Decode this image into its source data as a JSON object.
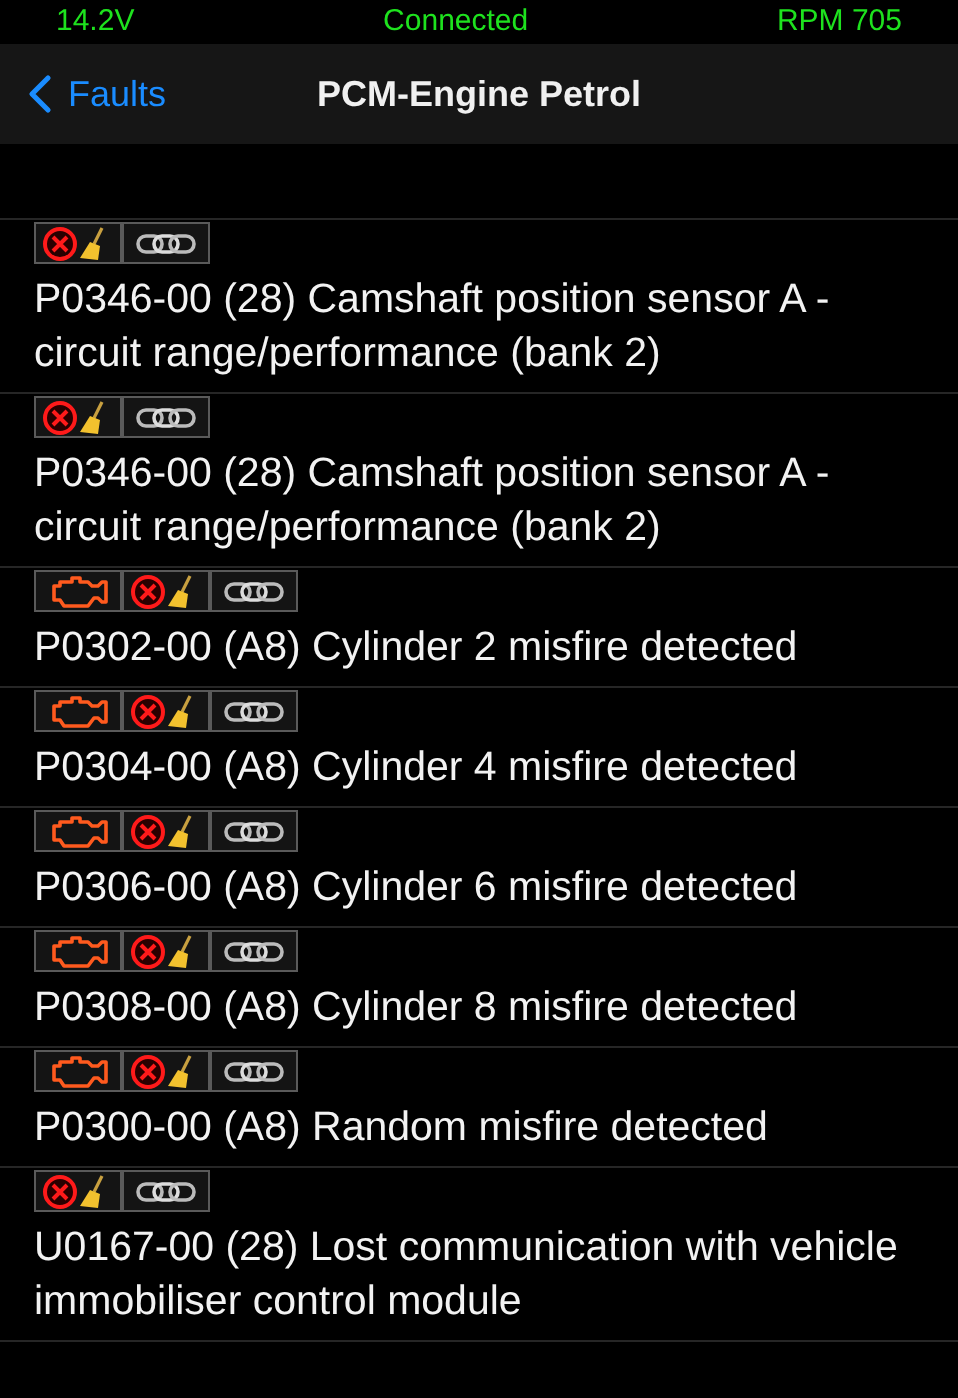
{
  "status_bar": {
    "voltage": "14.2V",
    "connection": "Connected",
    "rpm": "RPM 705"
  },
  "nav": {
    "back": "Faults",
    "title": "PCM-Engine Petrol"
  },
  "faults": [
    {
      "engine_light": false,
      "text": "P0346-00 (28) Camshaft position sensor A - circuit range/performance (bank 2)"
    },
    {
      "engine_light": false,
      "text": "P0346-00 (28) Camshaft position sensor A - circuit range/performance (bank 2)"
    },
    {
      "engine_light": true,
      "text": "P0302-00 (A8) Cylinder 2 misfire detected"
    },
    {
      "engine_light": true,
      "text": "P0304-00 (A8) Cylinder 4 misfire detected"
    },
    {
      "engine_light": true,
      "text": "P0306-00 (A8) Cylinder 6 misfire detected"
    },
    {
      "engine_light": true,
      "text": "P0308-00 (A8) Cylinder 8 misfire detected"
    },
    {
      "engine_light": true,
      "text": "P0300-00 (A8) Random misfire detected"
    },
    {
      "engine_light": false,
      "text": "U0167-00 (28) Lost communication with vehicle immobiliser control module"
    }
  ]
}
